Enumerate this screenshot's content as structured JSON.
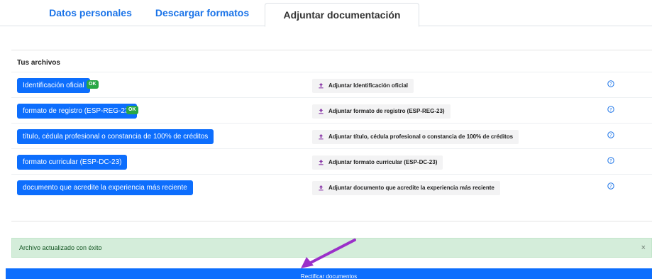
{
  "tabs": [
    {
      "label": "Datos personales"
    },
    {
      "label": "Descargar formatos"
    },
    {
      "label": "Adjuntar documentación"
    }
  ],
  "panel": {
    "title": "Tus archivos",
    "files": [
      {
        "label": "Identificación oficial",
        "badge": "OK",
        "attach": "Adjuntar Identificación oficial"
      },
      {
        "label": "formato de registro (ESP-REG-23)",
        "badge": "OK",
        "attach": "Adjuntar formato de registro (ESP-REG-23)"
      },
      {
        "label": "título, cédula profesional o constancia de 100% de créditos",
        "attach": "Adjuntar título, cédula profesional o constancia de 100% de créditos"
      },
      {
        "label": "formato curricular (ESP-DC-23)",
        "attach": "Adjuntar formato curricular (ESP-DC-23)"
      },
      {
        "label": "documento que acredite la experiencia más reciente",
        "attach": "Adjuntar documento que acredite la experiencia más reciente"
      }
    ]
  },
  "alert": {
    "text": "Archivo actualizado con éxito",
    "close": "×"
  },
  "main_button": {
    "label": "Rectificar documentos"
  },
  "colors": {
    "primary": "#0d6efd",
    "ok": "#28a745",
    "upload_icon": "#8a3aa8",
    "help_icon": "#1a73e8",
    "arrow": "#9b30c9"
  }
}
